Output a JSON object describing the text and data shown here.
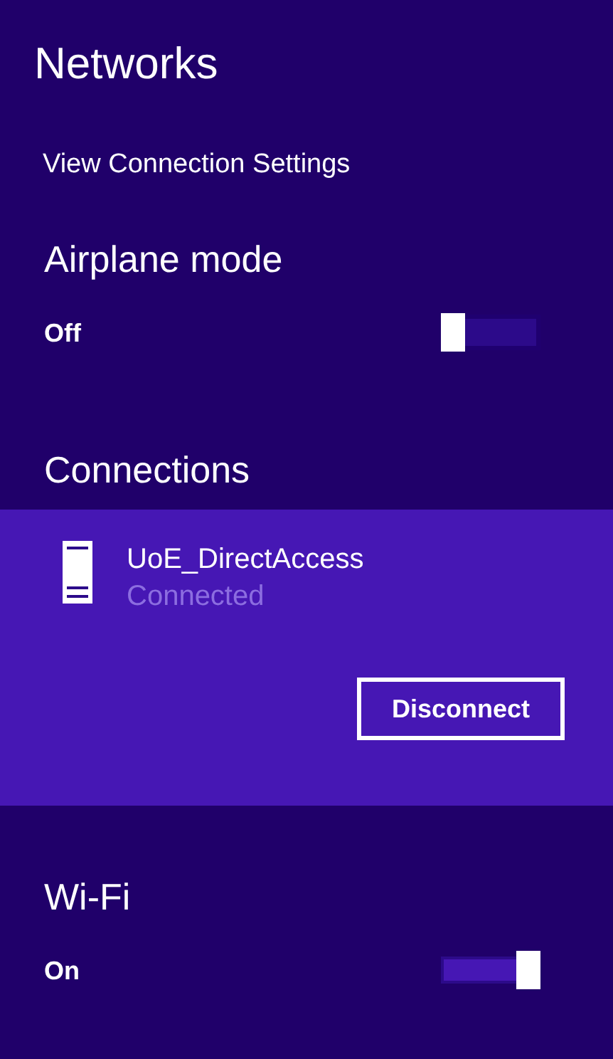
{
  "title": "Networks",
  "settings_link": "View Connection Settings",
  "airplane_mode": {
    "heading": "Airplane mode",
    "state_label": "Off",
    "on": false
  },
  "connections": {
    "heading": "Connections",
    "items": [
      {
        "name": "UoE_DirectAccess",
        "status": "Connected",
        "selected": true,
        "button": "Disconnect"
      }
    ]
  },
  "wifi": {
    "heading": "Wi-Fi",
    "state_label": "On",
    "on": true
  }
}
